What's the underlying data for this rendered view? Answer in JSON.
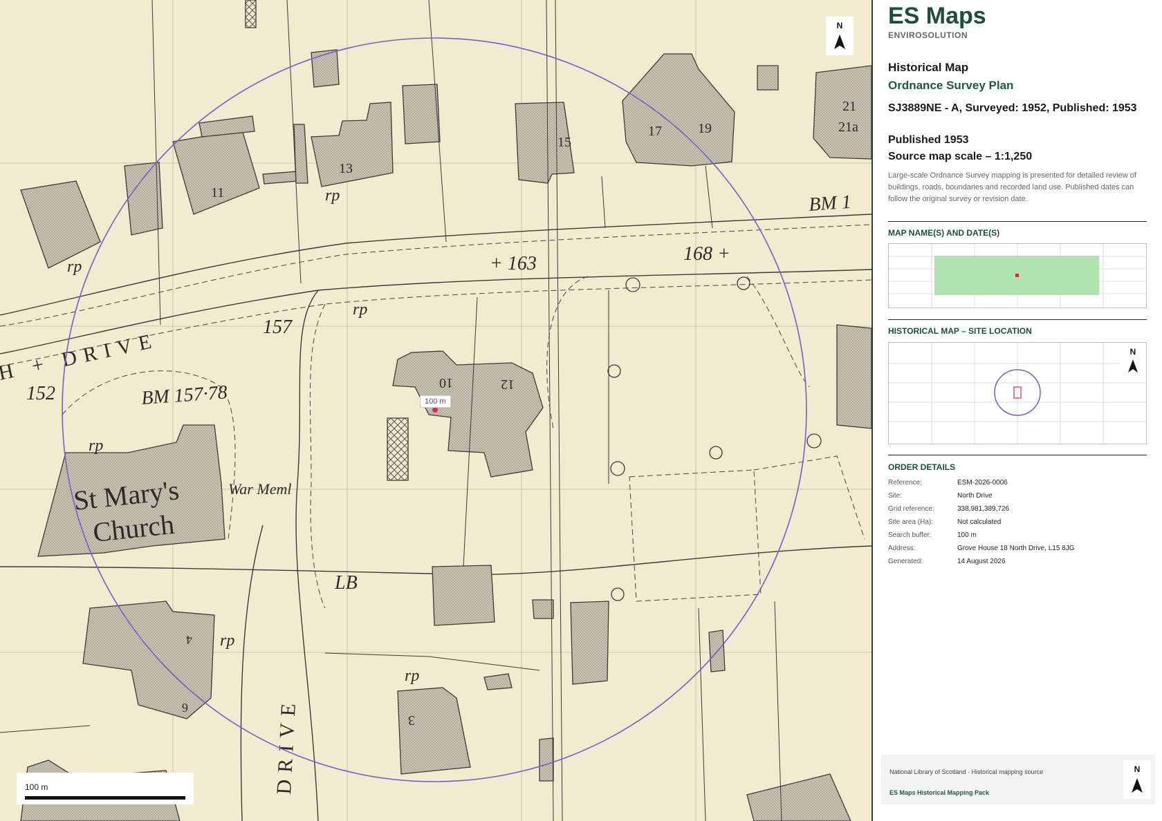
{
  "map": {
    "labels": {
      "drive_top": "H + DRIVE",
      "drive_bottom": "DRIVE",
      "church_line1": "St Mary's",
      "church_line2": "Church",
      "war_memorial": "War Meml",
      "bench_mark_157": "BM 157·78",
      "bench_mark_1": "BM 1",
      "spot_163": "+ 163",
      "spot_168": "168 +",
      "spot_157": "157",
      "spot_152": "152",
      "lb": "LB",
      "rp": "rp",
      "house_11": "11",
      "house_13": "13",
      "house_15": "15",
      "house_17": "17",
      "house_19": "19",
      "house_21": "21",
      "house_21a": "21a",
      "house_10": "10",
      "house_12": "12",
      "house_3": "3",
      "house_4": "4",
      "house_6": "6"
    },
    "buffer_label": "100 m",
    "scale_label": "100 m",
    "north_letter": "N"
  },
  "panel": {
    "brand": "ES Maps",
    "brand_sub": "ENVIROSOLUTION",
    "title": "Historical Map",
    "plan_type": "Ordnance Survey Plan",
    "map_code": "SJ3889NE - A, Surveyed: 1952, Published: 1953",
    "published": "Published 1953",
    "source_scale": "Source map scale – 1:1,250",
    "description": "Large-scale Ordnance Survey mapping is presented for detailed review of buildings, roads, boundaries and recorded land use. Published dates can follow the original survey or revision date.",
    "section_names": "MAP NAME(S) AND DATE(S)",
    "section_location": "HISTORICAL MAP – SITE LOCATION",
    "section_order": "ORDER DETAILS",
    "order_details": [
      {
        "key": "Reference:",
        "value": "ESM-2026-0006"
      },
      {
        "key": "Site:",
        "value": "North Drive"
      },
      {
        "key": "Grid reference:",
        "value": "338,981,389,726"
      },
      {
        "key": "Site area (Ha):",
        "value": "Not calculated"
      },
      {
        "key": "Search buffer:",
        "value": "100 m"
      },
      {
        "key": "Address:",
        "value": "Grove House 18 North Drive, L15 8JG"
      },
      {
        "key": "Generated:",
        "value": "14 August 2026"
      }
    ],
    "footer_source": "National Library of Scotland · Historical mapping source",
    "footer_name": "ES Maps Historical Mapping Pack"
  },
  "colors": {
    "paper": "#f1ebcf",
    "building": "#c9c4b2",
    "buffer_circle": "#7b5cc9",
    "brand_green": "#1e4d3a",
    "site_marker": "#d6285a",
    "timeline_fill": "#a6e0a6"
  }
}
